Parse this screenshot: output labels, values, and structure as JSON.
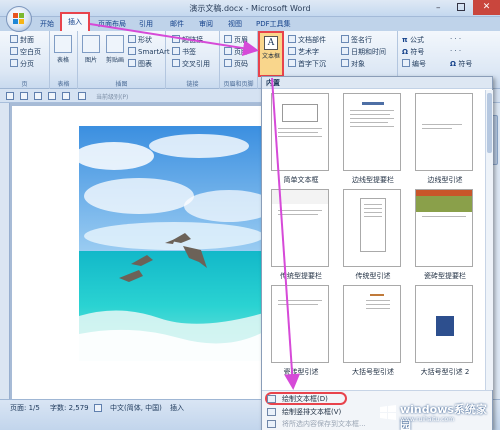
{
  "window": {
    "title": "演示文稿.docx - Microsoft Word",
    "minimize": "–",
    "close": "✕"
  },
  "tabs": {
    "start": "开始",
    "insert": "插入",
    "layout": "页面布局",
    "references": "引用",
    "mailings": "邮件",
    "review": "审阅",
    "view": "视图",
    "pdf": "PDF工具集"
  },
  "ribbon": {
    "pages": {
      "cover": "封面",
      "blank": "空白页",
      "break": "分页",
      "group": "页"
    },
    "table": {
      "table": "表格",
      "group": "表格"
    },
    "illustrations": {
      "picture": "图片",
      "clipart": "剪贴画",
      "shapes": "形状",
      "smartart": "SmartArt",
      "chart": "图表",
      "group": "插图"
    },
    "links": {
      "hyperlink": "超链接",
      "bookmark": "书签",
      "crossref": "交叉引用",
      "group": "链接"
    },
    "header_footer": {
      "header": "页眉",
      "footer": "页脚",
      "page_number": "页码",
      "group": "页眉和页脚"
    },
    "textbox": "文本框",
    "text": {
      "quick_parts": "文档部件",
      "wordart": "艺术字",
      "dropcap": "首字下沉",
      "signature": "签名行",
      "datetime": "日期和时间",
      "object": "对象"
    },
    "symbols": {
      "equation": "公式",
      "symbol": "符号",
      "number": "编号",
      "symbol2": "符号"
    },
    "dots": "·  ·  ·"
  },
  "qat": {
    "checkbox": "当前级别(P)"
  },
  "gallery": {
    "header": "内置",
    "templates": [
      {
        "label": "简单文本框"
      },
      {
        "label": "边线型提要栏"
      },
      {
        "label": "边线型引述"
      },
      {
        "label": "传统型提要栏"
      },
      {
        "label": "传统型引述"
      },
      {
        "label": "瓷砖型提要栏"
      },
      {
        "label": "瓷砖型引述"
      },
      {
        "label": "大括号型引述"
      },
      {
        "label": "大括号型引述 2"
      }
    ],
    "draw_textbox": "绘制文本框(D)",
    "draw_vertical_textbox": "绘制竖排文本框(V)",
    "save_selection": "将所选内容保存到文本框..."
  },
  "status": {
    "page": "页面: 1/5",
    "words": "字数: 2,579",
    "language": "中文(简体, 中国)",
    "mode": "插入"
  },
  "watermark": {
    "title": "windows系统家园",
    "subtitle": "www.ruihaitu.com"
  },
  "colors": {
    "highlight": "#e8434c",
    "arrow": "#d64ad8",
    "title_blue": "#15428b"
  }
}
